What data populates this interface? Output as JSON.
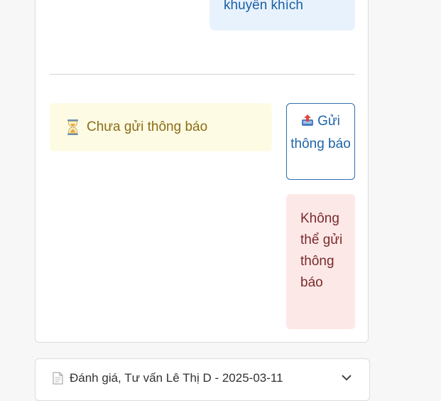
{
  "message": {
    "encouragement_text": "khuyến khích"
  },
  "notification": {
    "status_text": "Chưa gửi thông báo",
    "status_icon": "hourglass-icon",
    "send_button_label": "Gửi thông báo",
    "send_button_icon": "outbox-tray-icon",
    "error_text": "Không thể gửi thông báo"
  },
  "next_card": {
    "title": "Đánh giá, Tư vấn Lê Thị D - 2025-03-11",
    "doc_icon": "document-icon",
    "toggle_icon": "chevron-down-icon"
  },
  "colors": {
    "status_banner_bg": "#fefbe5",
    "status_text": "#8a6d14",
    "primary": "#1f64a8",
    "error_bg": "#fde8e8",
    "error_text": "#7a2a2a",
    "encourage_bg": "#e8f2fd"
  }
}
